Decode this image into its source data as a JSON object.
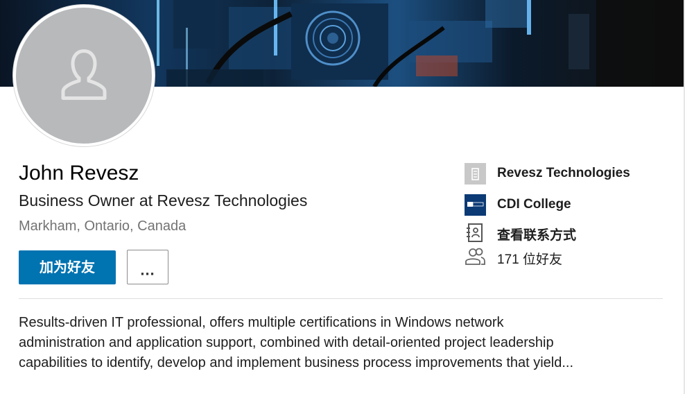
{
  "profile": {
    "name": "John Revesz",
    "headline": "Business Owner at Revesz Technologies",
    "location": "Markham, Ontario, Canada"
  },
  "actions": {
    "connect_label": "加为好友",
    "more_label": "..."
  },
  "side_info": {
    "current_company": "Revesz Technologies",
    "education": "CDI College",
    "education_logo_text": "CDI college",
    "contact_info": "查看联系方式",
    "connections": "171 位好友"
  },
  "summary": {
    "lines": [
      "Results-driven IT professional, offers multiple certifications in Windows network",
      "administration and application support, combined with detail-oriented project leadership",
      "capabilities to identify, develop and implement business process improvements that yield..."
    ]
  },
  "colors": {
    "primary_button": "#0073b1",
    "avatar_bg": "#b7b9bb",
    "cdi_logo_bg": "#0b3a75",
    "company_placeholder": "#c8c8c8"
  },
  "icons": {
    "company": "building-icon",
    "education": "cdi-college-logo",
    "contact": "contact-card-icon",
    "connections": "people-icon",
    "avatar": "person-silhouette-icon",
    "more": "ellipsis-icon"
  }
}
